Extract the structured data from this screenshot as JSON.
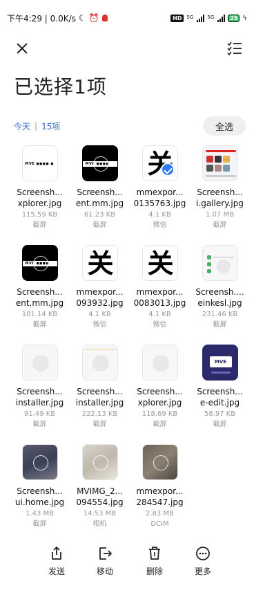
{
  "status_bar": {
    "time_speed": "下午4:29 | 0.0K/s",
    "hd": "HD",
    "sig1": "5G",
    "sig2": "5G",
    "battery": "25"
  },
  "header": {
    "title": "已选择1项"
  },
  "date_row": {
    "date": "今天",
    "separator": "|",
    "count": "15项",
    "select_all": "全选"
  },
  "files": [
    {
      "name1": "Screensh...",
      "name2": "xplorer.jpg",
      "size": "115.59 KB",
      "source": "截屏",
      "thumb": "mve-white"
    },
    {
      "name1": "Screensh...",
      "name2": "ent.mm.jpg",
      "size": "61.23 KB",
      "source": "截屏",
      "thumb": "mve-black"
    },
    {
      "name1": "mmexpor...",
      "name2": "0135763.jpg",
      "size": "4.1 KB",
      "source": "微信",
      "thumb": "glyph-selected"
    },
    {
      "name1": "Screensh...",
      "name2": "i.gallery.jpg",
      "size": "1.07 MB",
      "source": "截屏",
      "thumb": "gallery"
    },
    {
      "name1": "Screensh...",
      "name2": "ent.mm.jpg",
      "size": "101.14 KB",
      "source": "截屏",
      "thumb": "mve-black"
    },
    {
      "name1": "mmexpor...",
      "name2": "093932.jpg",
      "size": "4.1 KB",
      "source": "微信",
      "thumb": "glyph"
    },
    {
      "name1": "mmexpor...",
      "name2": "0083013.jpg",
      "size": "4.1 KB",
      "source": "微信",
      "thumb": "glyph"
    },
    {
      "name1": "Screensh....",
      "name2": "einkesl.jpg",
      "size": "231.46 KB",
      "source": "截屏",
      "thumb": "app-list"
    },
    {
      "name1": "Screensh...",
      "name2": "installer.jpg",
      "size": "91.49 KB",
      "source": "截屏",
      "thumb": "light"
    },
    {
      "name1": "Screensh...",
      "name2": "installer.jpg",
      "size": "222.13 KB",
      "source": "截屏",
      "thumb": "light-warm"
    },
    {
      "name1": "Screensh...",
      "name2": "xplorer.jpg",
      "size": "118.69 KB",
      "source": "截屏",
      "thumb": "light"
    },
    {
      "name1": "Screensh...",
      "name2": "e-edit.jpg",
      "size": "58.97 KB",
      "source": "截屏",
      "thumb": "mve-blue"
    },
    {
      "name1": "Screensh...",
      "name2": "ui.home.jpg",
      "size": "1.43 MB",
      "source": "截屏",
      "thumb": "photo1"
    },
    {
      "name1": "MVIMG_2...",
      "name2": "094554.jpg",
      "size": "14.53 MB",
      "source": "相机",
      "thumb": "photo2"
    },
    {
      "name1": "mmexpor...",
      "name2": "284547.jpg",
      "size": "2.83 MB",
      "source": "DCIM",
      "thumb": "photo3"
    }
  ],
  "actions": {
    "send": "发送",
    "move": "移动",
    "delete": "删除",
    "more": "更多"
  },
  "colors": {
    "accent": "#2f7cf6",
    "date_text": "#3b6fc9"
  }
}
